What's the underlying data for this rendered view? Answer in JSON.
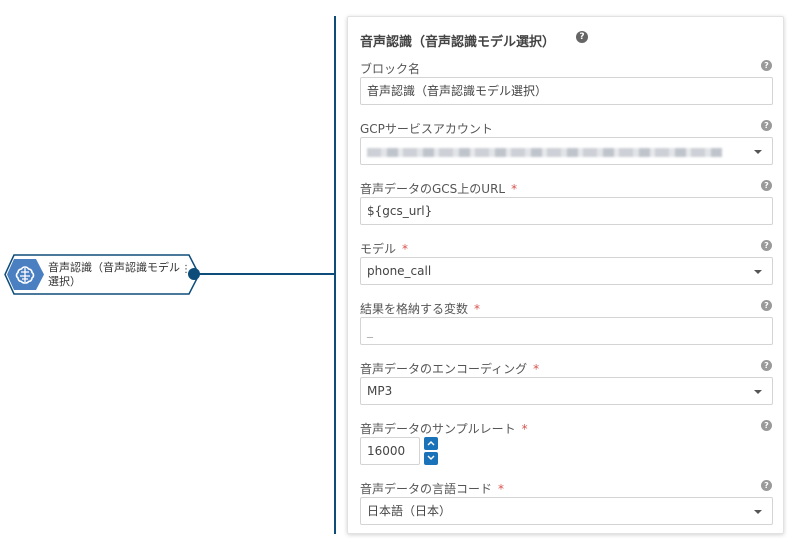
{
  "canvas": {
    "node": {
      "label": "音声認識（音声認識モデル選択）",
      "icon": "brain-icon",
      "handle_glyph": "⋮"
    }
  },
  "panel": {
    "title": "音声認識（音声認識モデル選択）",
    "help_glyph": "?",
    "required_mark": "*",
    "fields": {
      "block_name": {
        "label": "ブロック名",
        "value": "音声認識（音声認識モデル選択）"
      },
      "gcp_account": {
        "label": "GCPサービスアカウント",
        "value": ""
      },
      "gcs_url": {
        "label": "音声データのGCS上のURL",
        "value": "${gcs_url}"
      },
      "model": {
        "label": "モデル",
        "value": "phone_call"
      },
      "result_var": {
        "label": "結果を格納する変数",
        "value": "",
        "placeholder": "_"
      },
      "encoding": {
        "label": "音声データのエンコーディング",
        "value": "MP3"
      },
      "sample_rate": {
        "label": "音声データのサンプルレート",
        "value": "16000"
      },
      "language": {
        "label": "音声データの言語コード",
        "value": "日本語（日本）"
      }
    }
  },
  "colors": {
    "accent": "#0e4d7a",
    "spinner": "#1a73b8",
    "required": "#d9534f"
  }
}
